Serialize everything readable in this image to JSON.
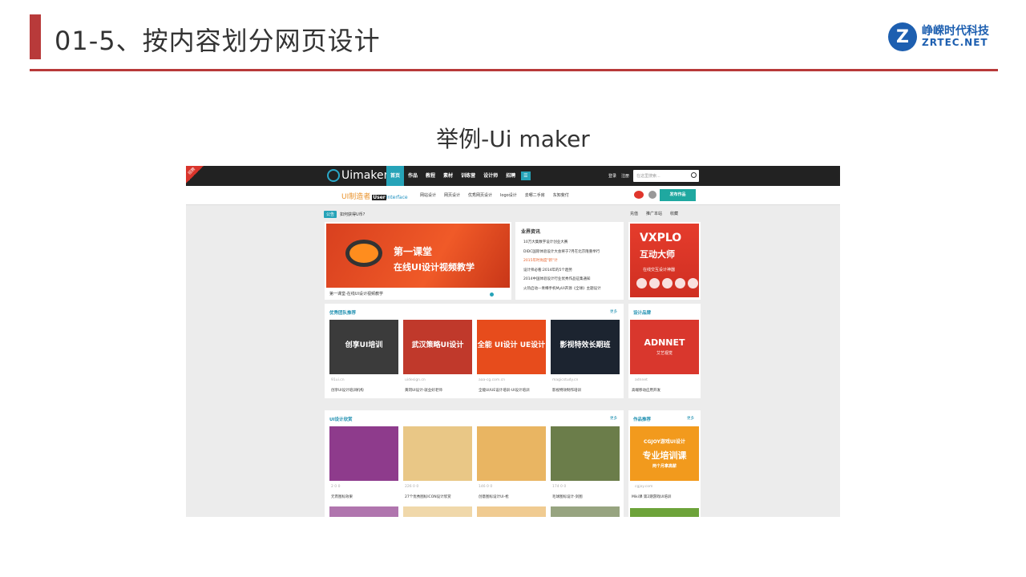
{
  "slide": {
    "title": "01-5、按内容划分网页设计",
    "subtitle": "举例-Ui maker",
    "logo_cn": "峥嵘时代科技",
    "logo_en": "ZRTEC.NET",
    "accent": "#b83a3a"
  },
  "site": {
    "ribbon": "招聘",
    "logo": "Uimaker",
    "nav": [
      "首页",
      "作品",
      "教程",
      "素材",
      "训练营",
      "设计师",
      "招聘"
    ],
    "nav_more": "☰",
    "login": "登录",
    "register": "注册",
    "search_placeholder": "在这里搜索...",
    "brand": "UI制造者",
    "brand_user": "User",
    "brand_interface": "Interface",
    "subnav": [
      "网站设计",
      "网页设计",
      "优秀网页设计",
      "logo设计",
      "去哪二手房",
      "东知斐付"
    ],
    "publish": "发布作品",
    "crumb_tag": "公告",
    "crumb_text": "如何获得U币?",
    "tools": [
      "充值",
      "推广本站",
      "收藏"
    ],
    "banner_title": "第一课堂",
    "banner_sub": "在线UI设计视频教学",
    "banner_caption": "第一课堂-在线UI设计视频教学",
    "news_title": "业界资讯",
    "news": [
      "10万大集数字设计创业大赛",
      "DIDC国际体验设计大会将于7月在北京隆重举行",
      "2015年时尚度\"新\"计",
      "设计师必看:2014年的5个趋势",
      "2014中国体验设计行业优秀作品征集通知",
      "火热启动—青樽手机MyUI开源《全球》主题设计"
    ],
    "promo_title": "VXPLO",
    "promo_sub": "互动大师",
    "promo_note": "在线交互设计神器",
    "section1_title": "优秀团队推荐",
    "section1_more": "更多",
    "section1_items": [
      {
        "label": "创享UI培训",
        "meta": "91ui.cn",
        "name": "创享UI设计培训机构",
        "color": "#3b3b3b"
      },
      {
        "label": "武汉策略UI设计",
        "meta": "uidesign.cn",
        "name": "黄冈UI设计-就业好老师",
        "color": "#c0392b"
      },
      {
        "label": "全能 UI设计 UE设计",
        "meta": "aaa-cg.com.cn",
        "name": "全能UI/UE设计培训-UI设计培训",
        "color": "#e74c1c"
      },
      {
        "label": "影视特效长期班",
        "meta": "magicstudy.cn",
        "name": "影视特效制作培训",
        "color": "#1c2430"
      }
    ],
    "side1_title": "设计品牌",
    "side1_item": {
      "label": "ADNNET",
      "sub": "艾艺视觉",
      "meta": "adnnet",
      "name": "高端移动应用开发"
    },
    "section2_title": "UI设计欣赏",
    "section2_more": "更多",
    "section2_items": [
      {
        "meta": "2   0       0",
        "name": "元宵图标效果",
        "color": "#8e3b8c"
      },
      {
        "meta": "226   0       0",
        "name": "27个优秀图标ICON设计欣赏",
        "color": "#e9c786"
      },
      {
        "meta": "146   0       0",
        "name": "创意图标设计UI-枪",
        "color": "#e9b562"
      },
      {
        "meta": "174   0       0",
        "name": "毛球图标设计-剑图",
        "color": "#6b7d4a"
      }
    ],
    "side2_title": "作品推荐",
    "side2_more": "更多",
    "side2_item": {
      "label": "CGJOY游戏UI设计",
      "sub": "专业培训课",
      "sub2": "两个月拿高薪",
      "meta": "cgjoy.com",
      "name": "Miki课 第2期游戏UI培训"
    }
  }
}
